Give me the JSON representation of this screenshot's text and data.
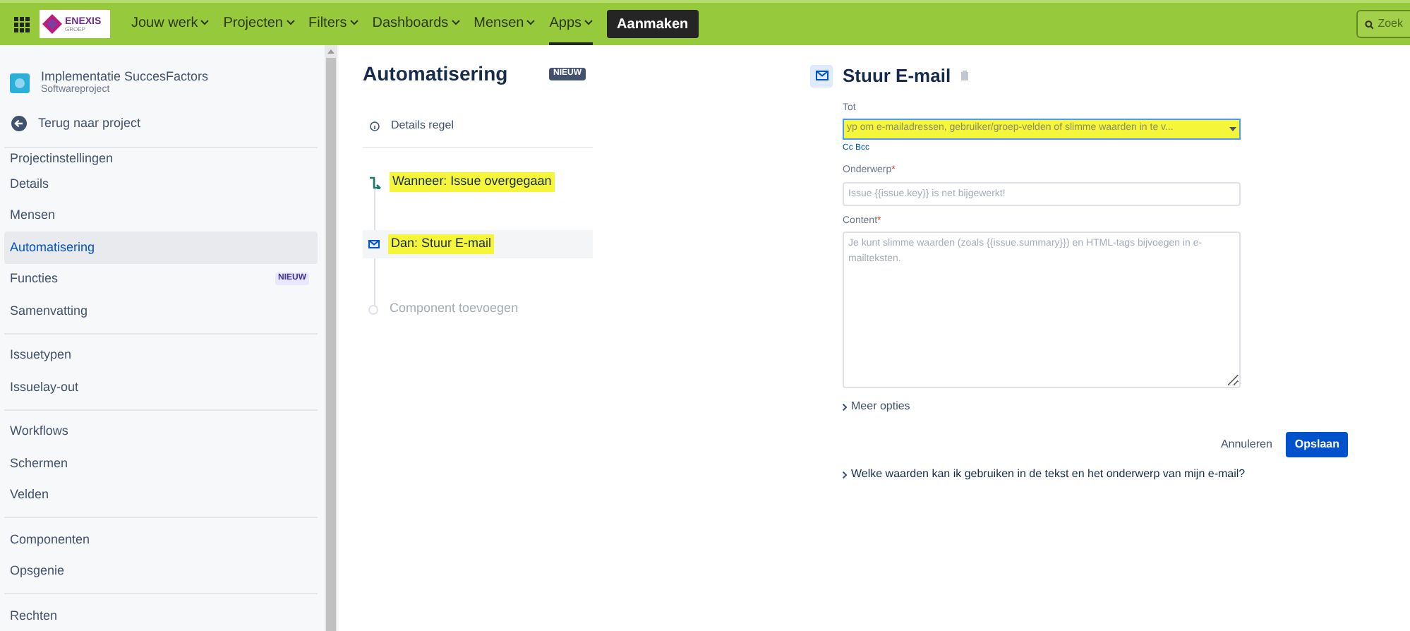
{
  "topbar": {
    "logo": {
      "name": "ENEXIS",
      "sub": "GROEP"
    },
    "nav": [
      {
        "label": "Jouw werk",
        "selected": false
      },
      {
        "label": "Projecten",
        "selected": false
      },
      {
        "label": "Filters",
        "selected": false
      },
      {
        "label": "Dashboards",
        "selected": false
      },
      {
        "label": "Mensen",
        "selected": false
      },
      {
        "label": "Apps",
        "selected": true
      }
    ],
    "create_button": "Aanmaken",
    "search": {
      "placeholder": "Zoek"
    }
  },
  "sidebar": {
    "project": {
      "name": "Implementatie SuccesFactors",
      "type": "Softwareproject"
    },
    "back": "Terug naar project",
    "heading": "Projectinstellingen",
    "groups": [
      [
        {
          "label": "Details",
          "selected": false
        },
        {
          "label": "Mensen",
          "selected": false
        },
        {
          "label": "Automatisering",
          "selected": true
        },
        {
          "label": "Functies",
          "selected": false,
          "badge": "NIEUW"
        },
        {
          "label": "Samenvatting",
          "selected": false
        }
      ],
      [
        {
          "label": "Issuetypen",
          "selected": false
        },
        {
          "label": "Issuelay-out",
          "selected": false
        }
      ],
      [
        {
          "label": "Workflows",
          "selected": false
        },
        {
          "label": "Schermen",
          "selected": false
        },
        {
          "label": "Velden",
          "selected": false
        }
      ],
      [
        {
          "label": "Componenten",
          "selected": false
        },
        {
          "label": "Opsgenie",
          "selected": false
        }
      ],
      [
        {
          "label": "Rechten",
          "selected": false
        }
      ]
    ]
  },
  "rule": {
    "title": "Automatisering",
    "badge": "NIEUW",
    "details": "Details regel",
    "steps": [
      {
        "kind": "trigger",
        "label": "Wanneer: Issue overgegaan",
        "selected": false,
        "highlighted": true
      },
      {
        "kind": "action",
        "label": "Dan: Stuur E-mail",
        "selected": true,
        "highlighted": true
      },
      {
        "kind": "add",
        "label": "Component toevoegen",
        "selected": false,
        "highlighted": false
      }
    ]
  },
  "form": {
    "title": "Stuur E-mail",
    "to": {
      "label": "Tot",
      "placeholder": "yp om e-mailadressen, gebruiker/groep-velden of slimme waarden in te v...",
      "highlighted": true
    },
    "cc_bcc": "Cc Bcc",
    "subject": {
      "label": "Onderwerp",
      "required_marker": "*",
      "placeholder": "Issue {{issue.key}} is net bijgewerkt!"
    },
    "content": {
      "label": "Content",
      "required_marker": "*",
      "placeholder": "Je kunt slimme waarden (zoals {{issue.summary}}) en HTML-tags bijvoegen in e-mailteksten."
    },
    "more_options": "Meer opties",
    "cancel": "Annuleren",
    "save": "Opslaan",
    "help": "Welke waarden kan ik gebruiken in de tekst en het onderwerp van mijn e-mail?"
  }
}
